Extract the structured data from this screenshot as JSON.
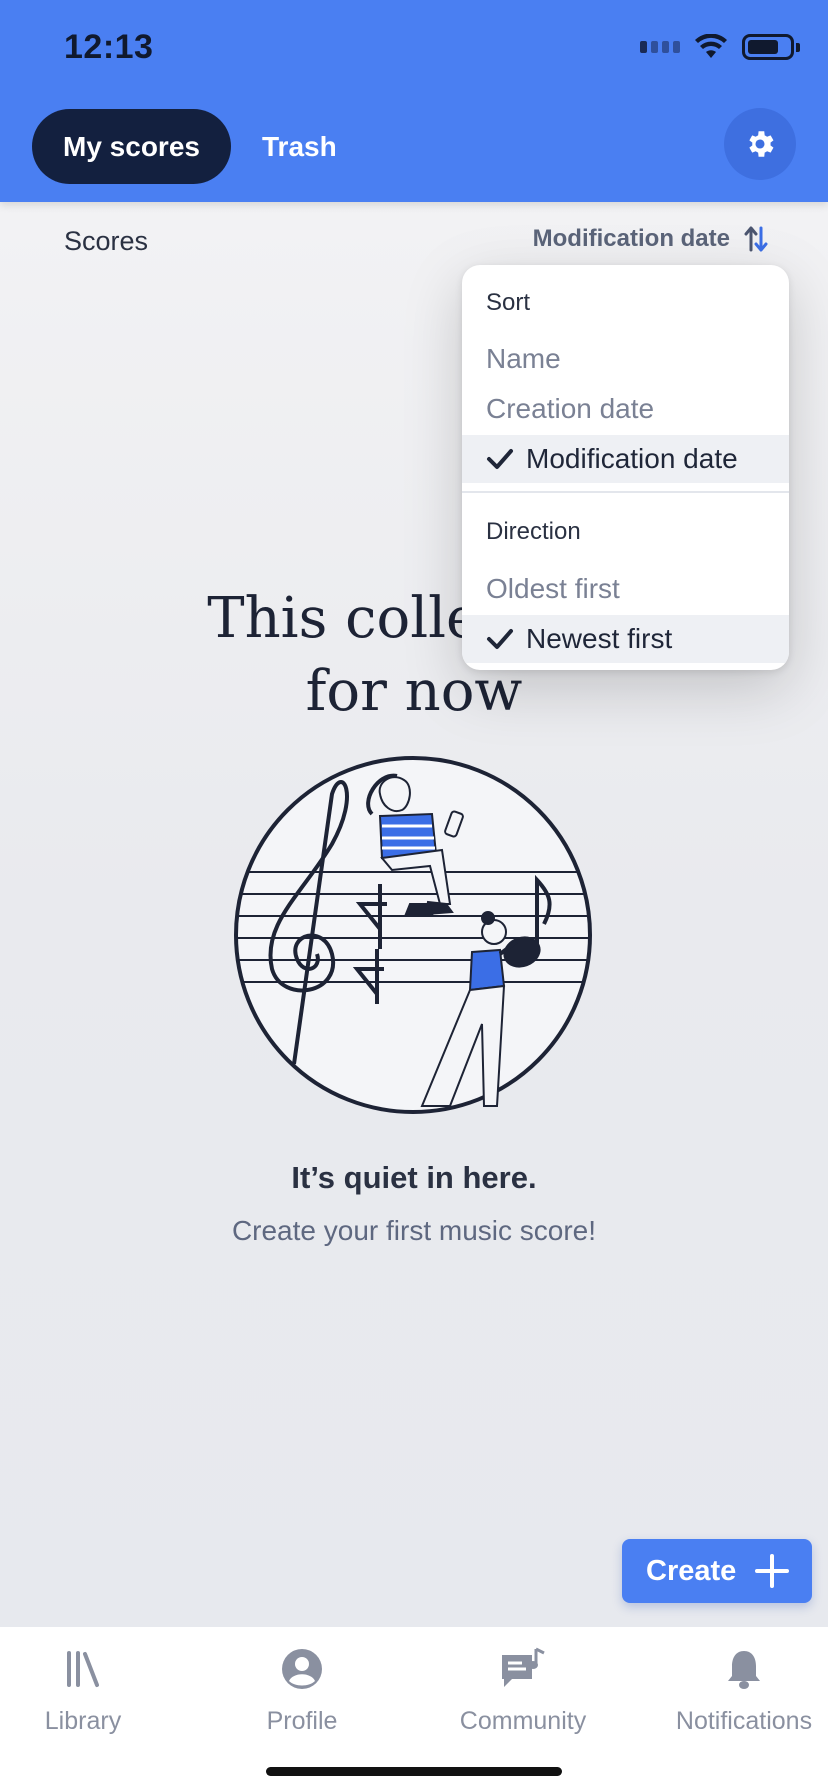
{
  "status_bar": {
    "time": "12:13"
  },
  "header": {
    "tabs": [
      {
        "label": "My scores",
        "active": true
      },
      {
        "label": "Trash",
        "active": false
      }
    ],
    "settings_icon": "gear-icon"
  },
  "list": {
    "section_label": "Scores",
    "sort_label": "Modification date",
    "sort_icon": "sort-arrows-icon"
  },
  "sort_menu": {
    "sort_heading": "Sort",
    "sort_options": [
      {
        "label": "Name",
        "selected": false
      },
      {
        "label": "Creation date",
        "selected": false
      },
      {
        "label": "Modification date",
        "selected": true
      }
    ],
    "direction_heading": "Direction",
    "direction_options": [
      {
        "label": "Oldest first",
        "selected": false
      },
      {
        "label": "Newest first",
        "selected": true
      }
    ]
  },
  "empty_state": {
    "title_line1": "This collection",
    "title_line2": "for now",
    "headline": "It’s quiet in here.",
    "subtext": "Create your first music score!"
  },
  "create_button": {
    "label": "Create"
  },
  "bottom_nav": {
    "items": [
      {
        "label": "Library",
        "icon": "library-icon"
      },
      {
        "label": "Profile",
        "icon": "profile-icon"
      },
      {
        "label": "Community",
        "icon": "community-icon"
      },
      {
        "label": "Notifications",
        "icon": "bell-icon"
      }
    ]
  },
  "colors": {
    "accent": "#4a7ff2",
    "active_tab": "#13203f"
  }
}
